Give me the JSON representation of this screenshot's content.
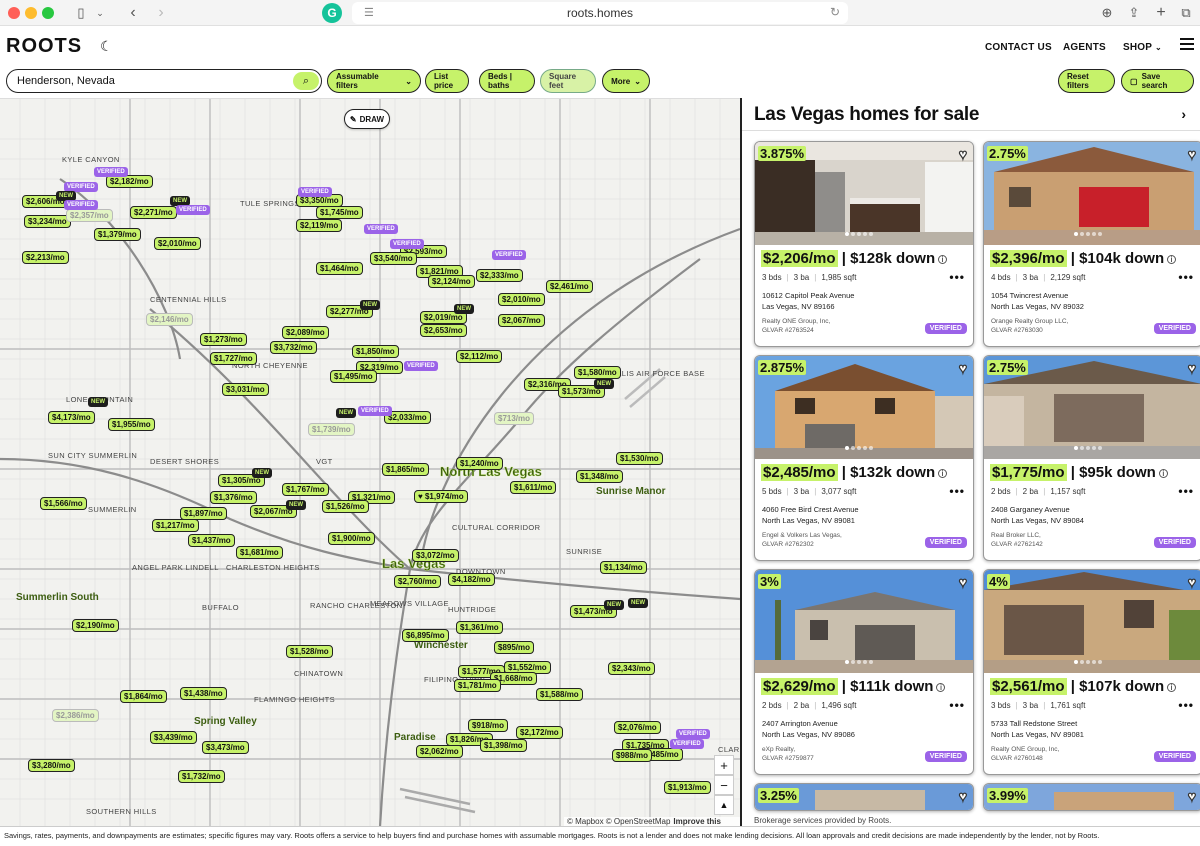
{
  "browser": {
    "url": "roots.homes"
  },
  "header": {
    "logo": "ROOTS",
    "nav": [
      "CONTACT US",
      "AGENTS",
      "SHOP"
    ]
  },
  "filters": {
    "search_value": "Henderson, Nevada",
    "buttons": [
      "Assumable filters",
      "List price",
      "Beds | baths",
      "Square feet",
      "More"
    ],
    "reset": "Reset filters",
    "save": "Save search"
  },
  "map": {
    "draw_label": "DRAW",
    "attribution": "© Mapbox © OpenStreetMap",
    "improve": "Improve this map",
    "places": [
      {
        "text": "KYLE CANYON"
      },
      {
        "text": "TULE SPRINGS"
      },
      {
        "text": "CENTENNIAL HILLS"
      },
      {
        "text": "NORTH CHEYENNE"
      },
      {
        "text": "LONE MOUNTAIN"
      },
      {
        "text": "SUN CITY SUMMERLIN"
      },
      {
        "text": "DESERT SHORES"
      },
      {
        "text": "SUMMERLIN"
      },
      {
        "text": "ANGEL PARK LINDELL"
      },
      {
        "text": "CHARLESTON HEIGHTS"
      },
      {
        "text": "BUFFALO"
      },
      {
        "text": "RANCHO CHARLESTON"
      },
      {
        "text": "MEADOWS VILLAGE"
      },
      {
        "text": "HUNTRIDGE"
      },
      {
        "text": "CULTURAL CORRIDOR"
      },
      {
        "text": "DOWNTOWN"
      },
      {
        "text": "SUNRISE"
      },
      {
        "text": "CHINATOWN"
      },
      {
        "text": "FLAMINGO HEIGHTS"
      },
      {
        "text": "FILIPINO TOWN"
      },
      {
        "text": "SOUTHERN HILLS"
      },
      {
        "text": "Nellis Air Force Base"
      },
      {
        "text": "VGT"
      },
      {
        "text": "Clark County"
      }
    ],
    "big_places": [
      "North Las Vegas",
      "Las Vegas"
    ],
    "mid_places": [
      "Summerlin South",
      "Spring Valley",
      "Paradise",
      "Winchester",
      "Sunrise Manor"
    ],
    "pins": [
      "$2,182/mo",
      "$2,606/mo",
      "$3,234/mo",
      "$2,357/mo",
      "$2,271/mo",
      "$1,379/mo",
      "$2,010/mo",
      "$2,213/mo",
      "$3,350/mo",
      "$1,745/mo",
      "$2,119/mo",
      "$2,593/mo",
      "$3,540/mo",
      "$1,821/mo",
      "$2,333/mo",
      "$2,124/mo",
      "$1,464/mo",
      "$2,461/mo",
      "$2,010/mo",
      "$2,067/mo",
      "$2,277/mo",
      "$2,019/mo",
      "$2,653/mo",
      "$2,146/mo",
      "$2,089/mo",
      "$3,732/mo",
      "$1,273/mo",
      "$1,727/mo",
      "$1,850/mo",
      "$2,319/mo",
      "$1,495/mo",
      "$2,112/mo",
      "$3,031/mo",
      "$1,580/mo",
      "$2,316/mo",
      "$1,573/mo",
      "$4,173/mo",
      "$1,955/mo",
      "$2,033/mo",
      "$1,739/mo",
      "$713/mo",
      "$1,865/mo",
      "$1,240/mo",
      "$1,530/mo",
      "$1,348/mo",
      "$1,305/mo",
      "$1,376/mo",
      "$1,767/mo",
      "$1,321/mo",
      "$1,974/mo",
      "$1,611/mo",
      "$1,566/mo",
      "$2,067/mo",
      "$1,526/mo",
      "$1,897/mo",
      "$1,217/mo",
      "$1,437/mo",
      "$1,900/mo",
      "$1,681/mo",
      "$3,072/mo",
      "$2,760/mo",
      "$4,182/mo",
      "$1,134/mo",
      "$2,190/mo",
      "$1,473/mo",
      "$1,361/mo",
      "$6,895/mo",
      "$895/mo",
      "$1,528/mo",
      "$1,552/mo",
      "$1,577/mo",
      "$1,668/mo",
      "$1,781/mo",
      "$2,343/mo",
      "$1,864/mo",
      "$1,438/mo",
      "$1,588/mo",
      "$2,386/mo",
      "$918/mo",
      "$2,172/mo",
      "$2,076/mo",
      "$3,439/mo",
      "$3,473/mo",
      "$1,826/mo",
      "$1,398/mo",
      "$2,062/mo",
      "$1,735/mo",
      "$2,485/mo",
      "$988/mo",
      "$3,280/mo",
      "$1,732/mo",
      "$1,913/mo"
    ]
  },
  "panel": {
    "title": "Las Vegas homes for sale",
    "listings": [
      {
        "rate": "3.875%",
        "mo": "$2,206/mo",
        "down": "| $128k down",
        "beds": "3 bds",
        "baths": "3 ba",
        "sqft": "1,985 sqft",
        "street": "10612 Capitol Peak Avenue",
        "city": "Las Vegas, NV 89166",
        "broker": "Realty ONE Group, Inc,",
        "glvar": "GLVAR #2763524",
        "badge": "VERIFIED"
      },
      {
        "rate": "2.75%",
        "mo": "$2,396/mo",
        "down": "| $104k down",
        "beds": "4 bds",
        "baths": "3 ba",
        "sqft": "2,129 sqft",
        "street": "1054 Twincrest Avenue",
        "city": "North Las Vegas, NV 89032",
        "broker": "Orange Realty Group LLC,",
        "glvar": "GLVAR #2763030",
        "badge": "VERIFIED"
      },
      {
        "rate": "2.875%",
        "mo": "$2,485/mo",
        "down": "| $132k down",
        "beds": "5 bds",
        "baths": "3 ba",
        "sqft": "3,077 sqft",
        "street": "4060 Free Bird Crest Avenue",
        "city": "North Las Vegas, NV 89081",
        "broker": "Engel & Volkers Las Vegas,",
        "glvar": "GLVAR #2762302",
        "badge": "VERIFIED"
      },
      {
        "rate": "2.75%",
        "mo": "$1,775/mo",
        "down": "| $95k down",
        "beds": "2 bds",
        "baths": "2 ba",
        "sqft": "1,157 sqft",
        "street": "2408 Garganey Avenue",
        "city": "North Las Vegas, NV 89084",
        "broker": "Real Broker LLC,",
        "glvar": "GLVAR #2762142",
        "badge": "VERIFIED"
      },
      {
        "rate": "3%",
        "mo": "$2,629/mo",
        "down": "| $111k down",
        "beds": "2 bds",
        "baths": "2 ba",
        "sqft": "1,496 sqft",
        "street": "2407 Arrington Avenue",
        "city": "North Las Vegas, NV 89086",
        "broker": "eXp Realty,",
        "glvar": "GLVAR #2759877",
        "badge": "VERIFIED"
      },
      {
        "rate": "4%",
        "mo": "$2,561/mo",
        "down": "| $107k down",
        "beds": "3 bds",
        "baths": "3 ba",
        "sqft": "1,761 sqft",
        "street": "5733 Tall Redstone Street",
        "city": "North Las Vegas, NV 89081",
        "broker": "Realty ONE Group, Inc,",
        "glvar": "GLVAR #2760148",
        "badge": "VERIFIED"
      },
      {
        "rate": "3.25%"
      },
      {
        "rate": "3.99%"
      }
    ],
    "brokerage_note": "Brokerage services provided by Roots."
  },
  "disclaimer": "Savings, rates, payments, and downpayments are estimates; specific figures may vary. Roots offers a service to help buyers find and purchase homes with assumable mortgages. Roots is not a lender and does not make lending decisions. All loan approvals and credit decisions are made independently by the lender, not by Roots.",
  "colors": {
    "accent": "#c6f26a",
    "verified": "#9b63e8",
    "ink": "#111111"
  },
  "icons": [
    "sidebar-icon",
    "back-icon",
    "forward-icon",
    "grammarly-icon",
    "page-icon",
    "reload-icon",
    "download-icon",
    "share-icon",
    "plus-icon",
    "tabs-icon",
    "moon-icon",
    "chevron-down-icon",
    "menu-icon",
    "search-icon",
    "save-icon",
    "pencil-icon",
    "heart-icon",
    "info-icon",
    "compass-icon"
  ]
}
